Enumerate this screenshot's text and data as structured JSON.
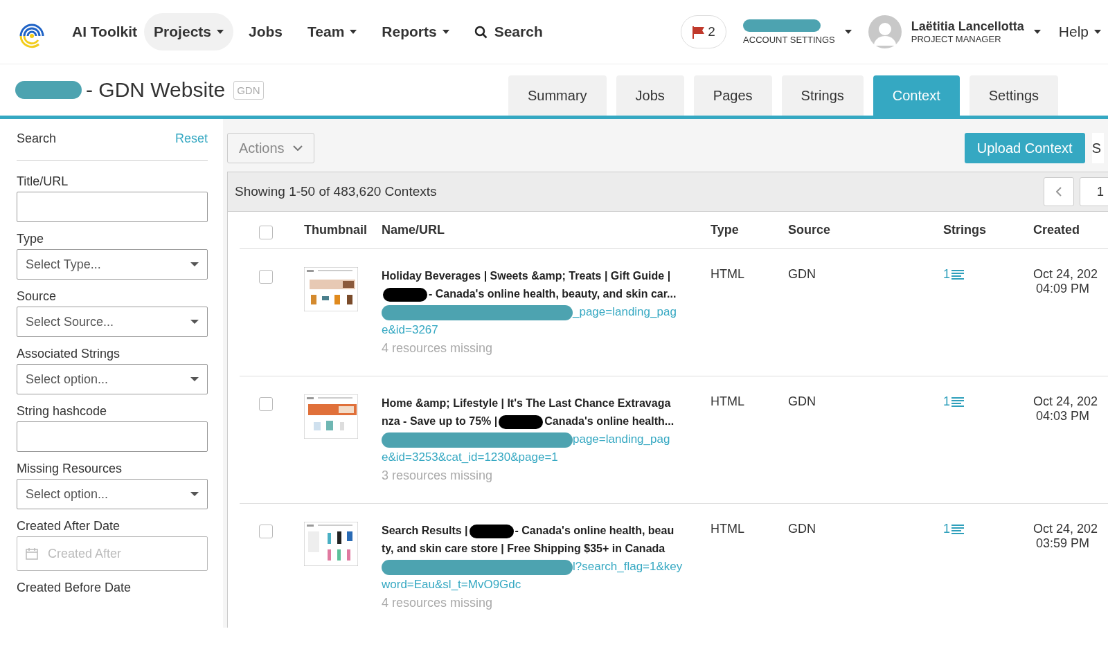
{
  "nav": {
    "brand": "AI Toolkit",
    "items": [
      {
        "label": "Projects",
        "dropdown": true,
        "selected": true
      },
      {
        "label": "Jobs",
        "dropdown": false,
        "selected": false
      },
      {
        "label": "Team",
        "dropdown": true,
        "selected": false
      },
      {
        "label": "Reports",
        "dropdown": true,
        "selected": false
      }
    ],
    "search": "Search",
    "flags": "2",
    "account": {
      "label": "ACCOUNT SETTINGS"
    },
    "user": {
      "name": "Laëtitia Lancellotta",
      "role": "PROJECT MANAGER"
    },
    "help": "Help"
  },
  "project": {
    "title": "- GDN Website",
    "code": "GDN"
  },
  "tabs": [
    {
      "label": "Summary",
      "selected": false
    },
    {
      "label": "Jobs",
      "selected": false
    },
    {
      "label": "Pages",
      "selected": false
    },
    {
      "label": "Strings",
      "selected": false
    },
    {
      "label": "Context",
      "selected": true
    },
    {
      "label": "Settings",
      "selected": false
    }
  ],
  "sidebar": {
    "title": "Search",
    "reset": "Reset",
    "filters": [
      {
        "kind": "text",
        "label": "Title/URL"
      },
      {
        "kind": "select",
        "label": "Type",
        "placeholder": "Select Type..."
      },
      {
        "kind": "select",
        "label": "Source",
        "placeholder": "Select Source..."
      },
      {
        "kind": "select",
        "label": "Associated Strings",
        "placeholder": "Select option..."
      },
      {
        "kind": "text",
        "label": "String hashcode"
      },
      {
        "kind": "select",
        "label": "Missing Resources",
        "placeholder": "Select option..."
      },
      {
        "kind": "date",
        "label": "Created After Date",
        "placeholder": "Created After"
      },
      {
        "kind": "heading",
        "label": "Created Before Date"
      }
    ]
  },
  "toolbar": {
    "actions": "Actions",
    "upload": "Upload Context",
    "cut_button": "S"
  },
  "select_all_checked": false,
  "summary": {
    "text": "Showing 1-50 of 483,620 Contexts",
    "page": "1"
  },
  "table": {
    "columns": [
      "Thumbnail",
      "Name/URL",
      "Type",
      "Source",
      "Strings",
      "Created"
    ],
    "rows": [
      {
        "checked": false,
        "title_lines": [
          [
            {
              "kind": "text",
              "text": "Holiday Beverages | Sweets &amp; Treats | Gift Guide |"
            }
          ],
          [
            {
              "kind": "redaction"
            },
            {
              "kind": "text",
              "text": "- Canada's online health, beauty, and skin car..."
            }
          ]
        ],
        "url_lines": [
          "_page=landing_pag",
          "e&id=3267"
        ],
        "missing": "4 resources missing",
        "type": "HTML",
        "source": "GDN",
        "strings": "1",
        "created_date": "Oct 24, 202",
        "created_time": "04:09 PM"
      },
      {
        "checked": false,
        "title_lines": [
          [
            {
              "kind": "text",
              "text": "Home &amp; Lifestyle | It's The Last Chance Extravaga"
            }
          ],
          [
            {
              "kind": "text",
              "text": "nza - Save up to 75% |"
            },
            {
              "kind": "redaction"
            },
            {
              "kind": "text",
              "text": "Canada's online health..."
            }
          ]
        ],
        "url_lines": [
          "page=landing_pag",
          "e&id=3253&cat_id=1230&page=1"
        ],
        "missing": "3 resources missing",
        "type": "HTML",
        "source": "GDN",
        "strings": "1",
        "created_date": "Oct 24, 202",
        "created_time": "04:03 PM"
      },
      {
        "checked": false,
        "title_lines": [
          [
            {
              "kind": "text",
              "text": "Search Results |"
            },
            {
              "kind": "redaction"
            },
            {
              "kind": "text",
              "text": "- Canada's online health, beau"
            }
          ],
          [
            {
              "kind": "text",
              "text": "ty, and skin care store | Free Shipping $35+ in Canada"
            }
          ]
        ],
        "url_lines": [
          "l?search_flag=1&key",
          "word=Eau&sl_t=MvO9Gdc"
        ],
        "missing": "4 resources missing",
        "type": "HTML",
        "source": "GDN",
        "strings": "1",
        "created_date": "Oct 24, 202",
        "created_time": "03:59 PM"
      }
    ]
  }
}
